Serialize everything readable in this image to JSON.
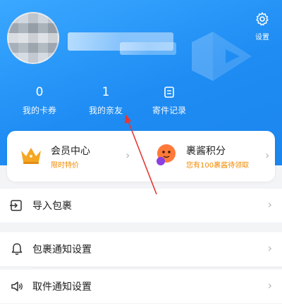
{
  "header": {
    "settings_label": "设置",
    "stats": [
      {
        "value": "0",
        "label": "我的卡券"
      },
      {
        "value": "1",
        "label": "我的亲友"
      },
      {
        "label": "寄件记录",
        "icon": "document-icon"
      }
    ]
  },
  "member": {
    "left": {
      "title": "会员中心",
      "subtitle": "限时特价",
      "icon": "crown-icon"
    },
    "right": {
      "title": "裹酱积分",
      "subtitle": "您有100裹酱待领取",
      "icon": "mascot-icon"
    }
  },
  "menu": [
    {
      "label": "导入包裹",
      "icon": "import-icon"
    },
    {
      "label": "包裹通知设置",
      "icon": "bell-icon"
    },
    {
      "label": "取件通知设置",
      "icon": "speaker-icon"
    }
  ],
  "colors": {
    "header_blue": "#1e8cf3",
    "accent_orange": "#f08a00",
    "annotation_red": "#e53935"
  }
}
